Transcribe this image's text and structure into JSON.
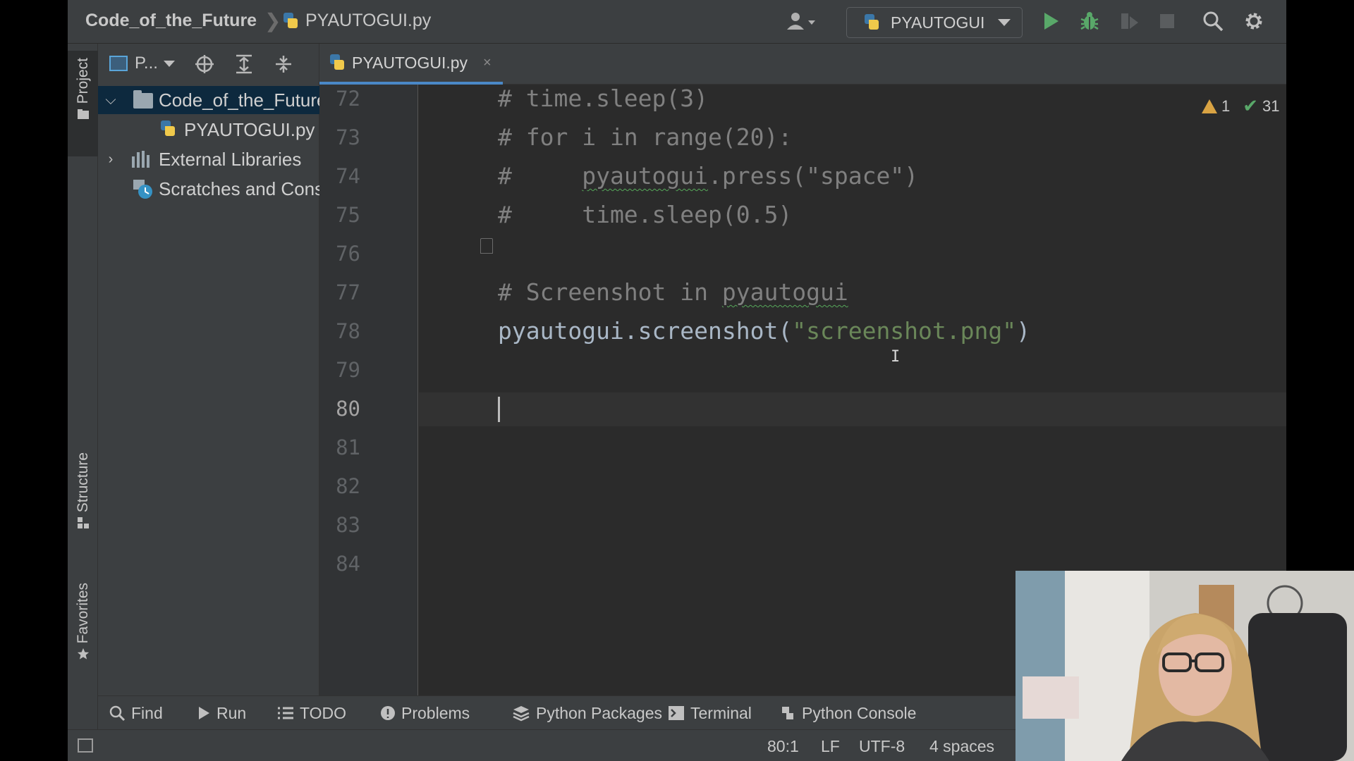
{
  "navbar": {
    "project_name": "Code_of_the_Future",
    "separator": "❯",
    "file_name": "PYAUTOGUI.py",
    "run_config": "PYAUTOGUI"
  },
  "sidebar_tabs": {
    "project": "Project",
    "structure": "Structure",
    "favorites": "Favorites"
  },
  "project_panel": {
    "view_label": "P...",
    "tree": [
      {
        "label": "Code_of_the_Future",
        "type": "folder",
        "expanded": true
      },
      {
        "label": "PYAUTOGUI.py",
        "type": "python-file"
      },
      {
        "label": "External Libraries",
        "type": "library",
        "expanded": false
      },
      {
        "label": "Scratches and Consoles",
        "type": "scratches"
      }
    ]
  },
  "editor_tab": {
    "label": "PYAUTOGUI.py",
    "close": "×"
  },
  "inspections": {
    "warnings": "1",
    "ok": "31"
  },
  "line_numbers": [
    "72",
    "73",
    "74",
    "75",
    "76",
    "77",
    "78",
    "79",
    "80",
    "81",
    "82",
    "83",
    "84"
  ],
  "current_line": "80",
  "code": {
    "l72": "# time.sleep(3)",
    "l73": "# for i in range(20):",
    "l74_hash": "#     ",
    "l74_ident": "pyautogui",
    "l74_rest": ".press(\"space\")",
    "l75": "#     time.sleep(0.5)",
    "l77_prefix": "# Screenshot in ",
    "l77_ident": "pyautogui",
    "l78_call": "pyautogui.screenshot(",
    "l78_string": "\"screenshot.png\"",
    "l78_close": ")"
  },
  "tool_windows": [
    {
      "label": "Find",
      "icon": "search-icon"
    },
    {
      "label": "Run",
      "icon": "run-icon"
    },
    {
      "label": "TODO",
      "icon": "todo-list-icon"
    },
    {
      "label": "Problems",
      "icon": "problems-icon"
    },
    {
      "label": "Python Packages",
      "icon": "packages-icon"
    },
    {
      "label": "Terminal",
      "icon": "terminal-icon"
    },
    {
      "label": "Python Console",
      "icon": "python-console-icon"
    }
  ],
  "status": {
    "position": "80:1",
    "line_separator": "LF",
    "encoding": "UTF-8",
    "indent": "4 spaces"
  },
  "colors": {
    "editor_bg": "#2b2b2b",
    "panel_bg": "#3c3f41",
    "comment": "#808080",
    "string": "#6a8759",
    "default_code": "#a9b7c6",
    "run_green": "#59a869",
    "tab_underline": "#4a88c7"
  }
}
